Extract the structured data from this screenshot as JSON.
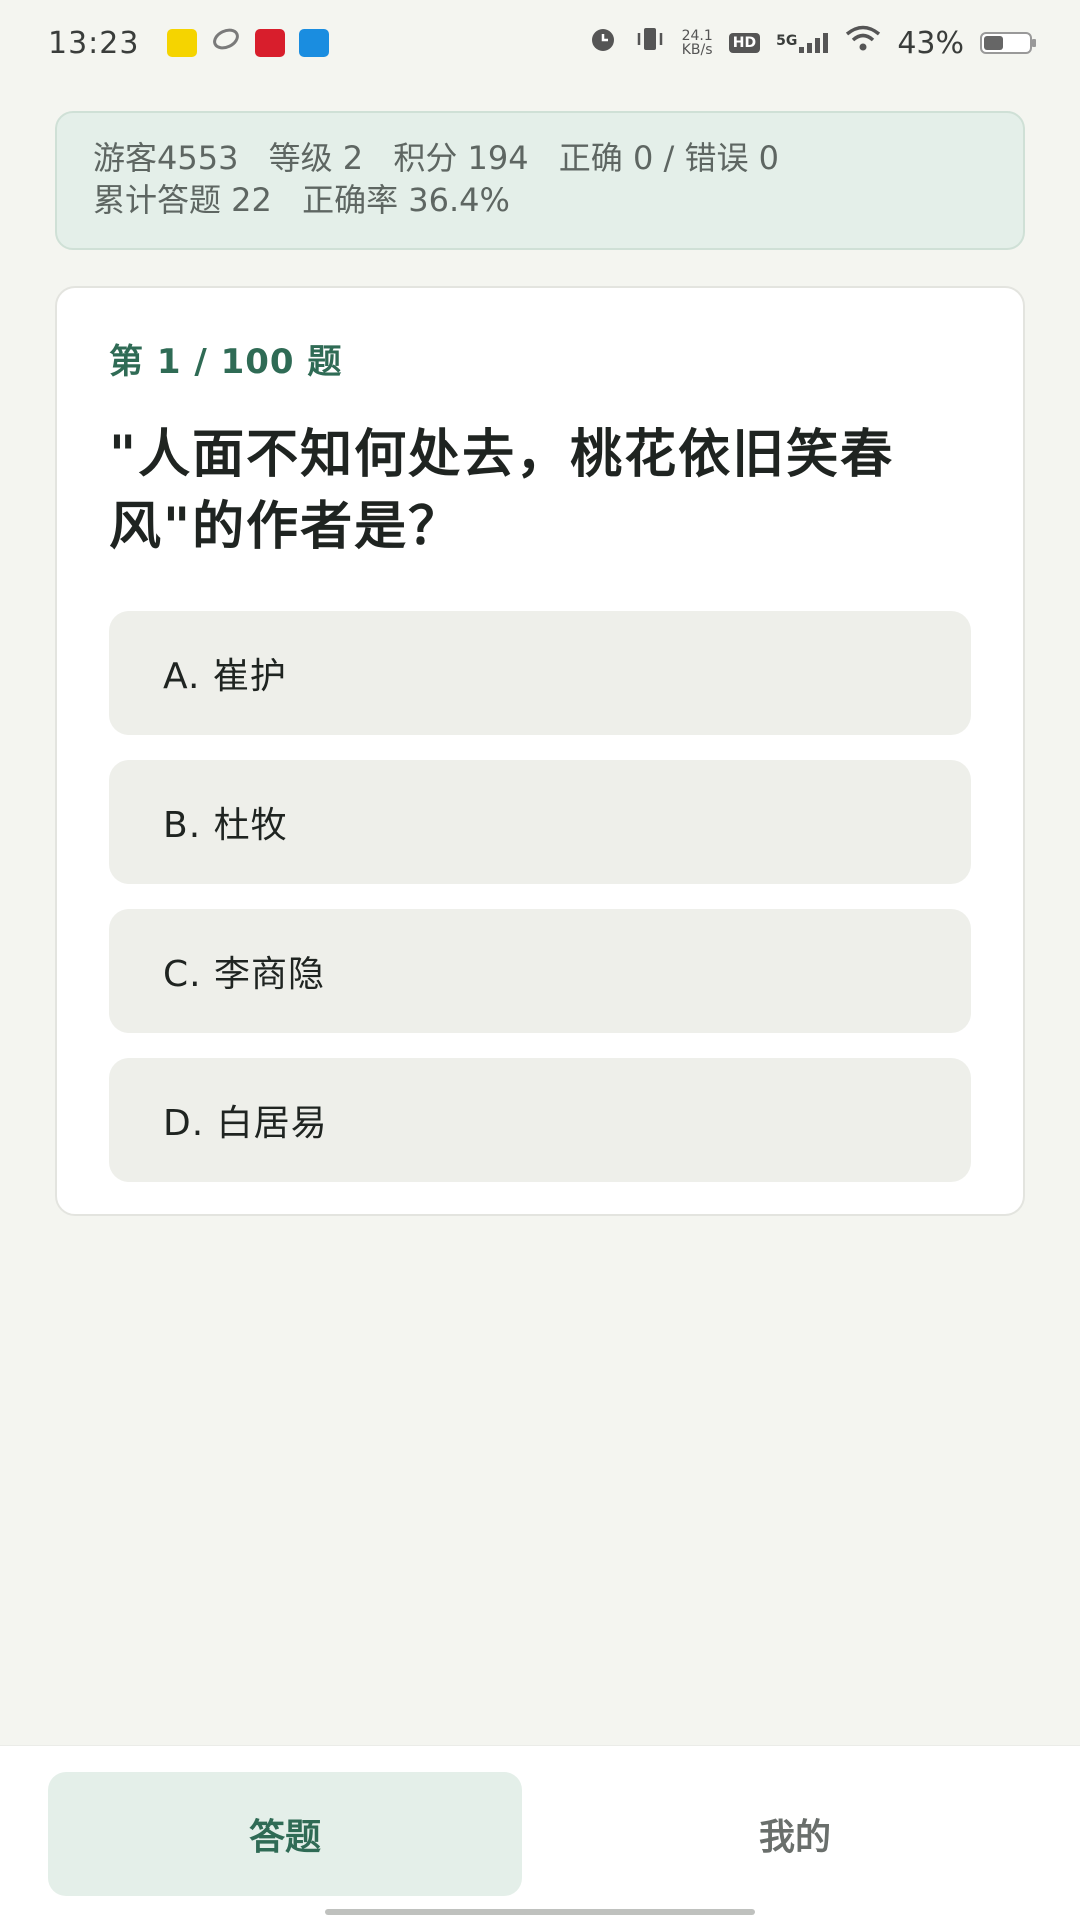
{
  "status_bar": {
    "time": "13:23",
    "net_speed_value": "24.1",
    "net_speed_unit": "KB/s",
    "hd": "HD",
    "network": "5G",
    "battery_percent": "43%",
    "battery_level": 0.43,
    "app_icon_colors": [
      "#f5d400",
      "#7a7a7a",
      "#d81e2c",
      "#1a8de0"
    ]
  },
  "stats": {
    "user": "游客4553",
    "level": "等级 2",
    "points": "积分 194",
    "score": "正确 0 / 错误 0",
    "total": "累计答题 22",
    "accuracy": "正确率 36.4%"
  },
  "question": {
    "progress": "第 1 / 100 题",
    "text": "\"人面不知何处去，桃花依旧笑春风\"的作者是？",
    "options": [
      "A. 崔护",
      "B. 杜牧",
      "C. 李商隐",
      "D. 白居易"
    ]
  },
  "tabs": {
    "answer": "答题",
    "mine": "我的"
  },
  "colors": {
    "accent": "#2f6b55",
    "accent_bg": "#e4efe9",
    "page_bg": "#f4f5f0"
  }
}
